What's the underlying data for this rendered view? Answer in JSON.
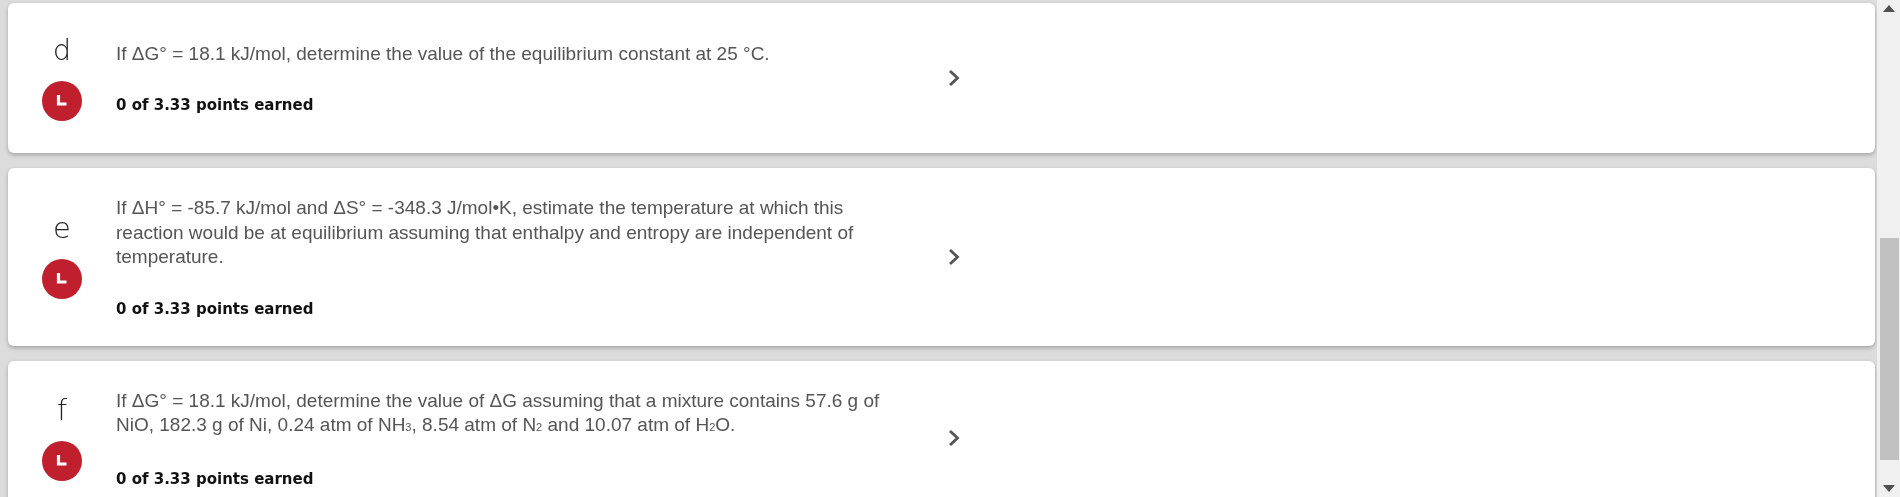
{
  "questions": [
    {
      "letter": "d",
      "text": "If ΔG° = 18.1 kJ/mol, determine the value of the equilibrium constant at 25 °C.",
      "points": "0 of 3.33 points earned"
    },
    {
      "letter": "e",
      "text": "If ΔH° = -85.7 kJ/mol and ΔS° = -348.3 J/mol•K, estimate the temperature at which this reaction would be at equilibrium assuming that enthalpy and entropy are independent of temperature.",
      "points": "0 of 3.33 points earned"
    },
    {
      "letter": "f",
      "text": "If ΔG° = 18.1 kJ/mol, determine the value of ΔG assuming that a mixture contains 57.6 g of NiO, 182.3 g of Ni, 0.24 atm of NH$_{3}$, 8.54 atm of N$_{2}$ and 10.07 atm of H$_{2}$O.",
      "points": "0 of 3.33 points earned"
    }
  ]
}
